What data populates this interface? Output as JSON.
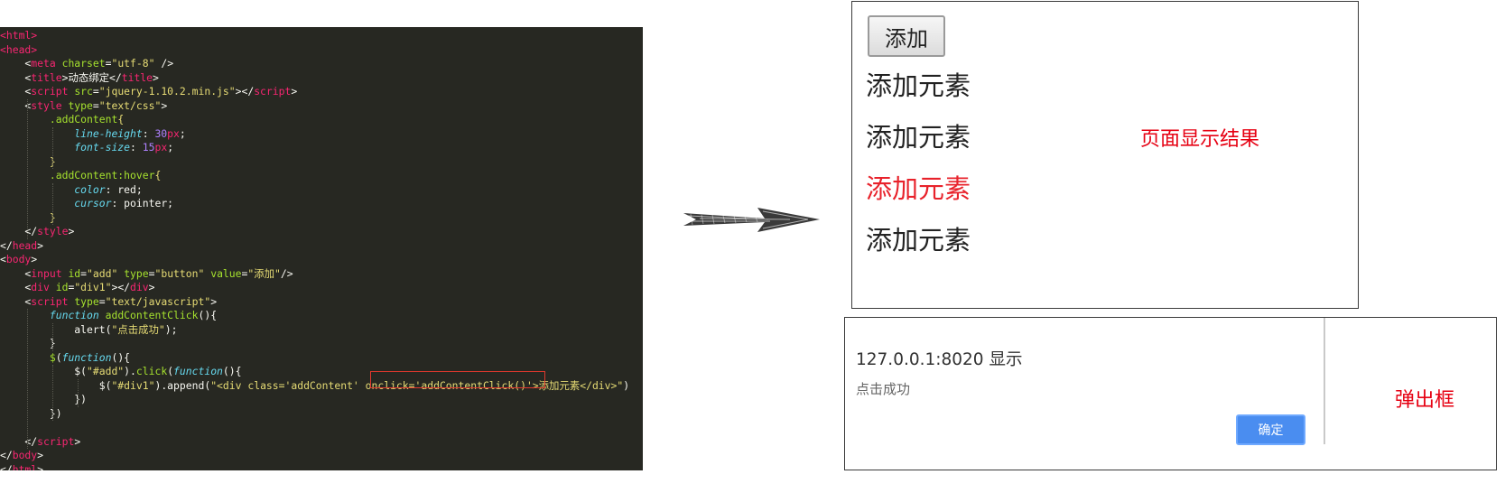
{
  "code": {
    "lines": [
      [
        {
          "c": "tag",
          "t": "<html>"
        }
      ],
      [
        {
          "c": "tag",
          "t": "<head>"
        }
      ],
      [
        {
          "c": "plain",
          "t": "    <"
        },
        {
          "c": "tag",
          "t": "meta"
        },
        {
          "c": "plain",
          "t": " "
        },
        {
          "c": "attr",
          "t": "charset"
        },
        {
          "c": "plain",
          "t": "="
        },
        {
          "c": "str",
          "t": "\"utf-8\""
        },
        {
          "c": "plain",
          "t": " />"
        }
      ],
      [
        {
          "c": "plain",
          "t": "    <"
        },
        {
          "c": "tag",
          "t": "title"
        },
        {
          "c": "plain",
          "t": ">动态绑定</"
        },
        {
          "c": "tag",
          "t": "title"
        },
        {
          "c": "plain",
          "t": ">"
        }
      ],
      [
        {
          "c": "plain",
          "t": "    <"
        },
        {
          "c": "tag",
          "t": "script"
        },
        {
          "c": "plain",
          "t": " "
        },
        {
          "c": "attr",
          "t": "src"
        },
        {
          "c": "plain",
          "t": "="
        },
        {
          "c": "str",
          "t": "\"jquery-1.10.2.min.js\""
        },
        {
          "c": "plain",
          "t": "></"
        },
        {
          "c": "tag",
          "t": "script"
        },
        {
          "c": "plain",
          "t": ">"
        }
      ],
      [
        {
          "c": "plain",
          "t": "    <"
        },
        {
          "c": "tag",
          "t": "style"
        },
        {
          "c": "plain",
          "t": " "
        },
        {
          "c": "attr",
          "t": "type"
        },
        {
          "c": "plain",
          "t": "="
        },
        {
          "c": "str",
          "t": "\"text/css\""
        },
        {
          "c": "plain",
          "t": ">"
        }
      ],
      [
        {
          "c": "plain",
          "t": "        "
        },
        {
          "c": "sel",
          "t": ".addContent"
        },
        {
          "c": "brace",
          "t": "{"
        }
      ],
      [
        {
          "c": "plain",
          "t": "            "
        },
        {
          "c": "prop",
          "t": "line-height"
        },
        {
          "c": "plain",
          "t": ": "
        },
        {
          "c": "num",
          "t": "30"
        },
        {
          "c": "tag",
          "t": "px"
        },
        {
          "c": "plain",
          "t": ";"
        }
      ],
      [
        {
          "c": "plain",
          "t": "            "
        },
        {
          "c": "prop",
          "t": "font-size"
        },
        {
          "c": "plain",
          "t": ": "
        },
        {
          "c": "num",
          "t": "15"
        },
        {
          "c": "tag",
          "t": "px"
        },
        {
          "c": "plain",
          "t": ";"
        }
      ],
      [
        {
          "c": "plain",
          "t": "        "
        },
        {
          "c": "brace",
          "t": "}"
        }
      ],
      [
        {
          "c": "plain",
          "t": "        "
        },
        {
          "c": "sel",
          "t": ".addContent:hover"
        },
        {
          "c": "brace",
          "t": "{"
        }
      ],
      [
        {
          "c": "plain",
          "t": "            "
        },
        {
          "c": "prop",
          "t": "color"
        },
        {
          "c": "plain",
          "t": ": red;"
        }
      ],
      [
        {
          "c": "plain",
          "t": "            "
        },
        {
          "c": "prop",
          "t": "cursor"
        },
        {
          "c": "plain",
          "t": ": pointer;"
        }
      ],
      [
        {
          "c": "plain",
          "t": "        "
        },
        {
          "c": "brace",
          "t": "}"
        }
      ],
      [
        {
          "c": "plain",
          "t": "    </"
        },
        {
          "c": "tag",
          "t": "style"
        },
        {
          "c": "plain",
          "t": ">"
        }
      ],
      [
        {
          "c": "plain",
          "t": "</"
        },
        {
          "c": "tag",
          "t": "head"
        },
        {
          "c": "plain",
          "t": ">"
        }
      ],
      [
        {
          "c": "plain",
          "t": "<"
        },
        {
          "c": "tag",
          "t": "body"
        },
        {
          "c": "plain",
          "t": ">"
        }
      ],
      [
        {
          "c": "plain",
          "t": "    <"
        },
        {
          "c": "tag",
          "t": "input"
        },
        {
          "c": "plain",
          "t": " "
        },
        {
          "c": "attr",
          "t": "id"
        },
        {
          "c": "plain",
          "t": "="
        },
        {
          "c": "str",
          "t": "\"add\""
        },
        {
          "c": "plain",
          "t": " "
        },
        {
          "c": "attr",
          "t": "type"
        },
        {
          "c": "plain",
          "t": "="
        },
        {
          "c": "str",
          "t": "\"button\""
        },
        {
          "c": "plain",
          "t": " "
        },
        {
          "c": "attr",
          "t": "value"
        },
        {
          "c": "plain",
          "t": "="
        },
        {
          "c": "str",
          "t": "\"添加\""
        },
        {
          "c": "plain",
          "t": "/>"
        }
      ],
      [
        {
          "c": "plain",
          "t": "    <"
        },
        {
          "c": "tag",
          "t": "div"
        },
        {
          "c": "plain",
          "t": " "
        },
        {
          "c": "attr",
          "t": "id"
        },
        {
          "c": "plain",
          "t": "="
        },
        {
          "c": "str",
          "t": "\"div1\""
        },
        {
          "c": "plain",
          "t": "></"
        },
        {
          "c": "tag",
          "t": "div"
        },
        {
          "c": "plain",
          "t": ">"
        }
      ],
      [
        {
          "c": "plain",
          "t": "    <"
        },
        {
          "c": "tag",
          "t": "script"
        },
        {
          "c": "plain",
          "t": " "
        },
        {
          "c": "attr",
          "t": "type"
        },
        {
          "c": "plain",
          "t": "="
        },
        {
          "c": "str",
          "t": "\"text/javascript\""
        },
        {
          "c": "plain",
          "t": ">"
        }
      ],
      [
        {
          "c": "plain",
          "t": "        "
        },
        {
          "c": "kw",
          "t": "function"
        },
        {
          "c": "plain",
          "t": " "
        },
        {
          "c": "fn",
          "t": "addContentClick"
        },
        {
          "c": "plain",
          "t": "(){"
        }
      ],
      [
        {
          "c": "plain",
          "t": "            alert("
        },
        {
          "c": "str",
          "t": "\"点击成功\""
        },
        {
          "c": "plain",
          "t": ");"
        }
      ],
      [
        {
          "c": "plain",
          "t": "        }"
        }
      ],
      [
        {
          "c": "plain",
          "t": "        "
        },
        {
          "c": "fn",
          "t": "$"
        },
        {
          "c": "plain",
          "t": "("
        },
        {
          "c": "kw",
          "t": "function"
        },
        {
          "c": "plain",
          "t": "(){"
        }
      ],
      [
        {
          "c": "plain",
          "t": "            $("
        },
        {
          "c": "str",
          "t": "\"#add\""
        },
        {
          "c": "plain",
          "t": ")."
        },
        {
          "c": "fn",
          "t": "click"
        },
        {
          "c": "plain",
          "t": "("
        },
        {
          "c": "kw",
          "t": "function"
        },
        {
          "c": "plain",
          "t": "(){"
        }
      ],
      [
        {
          "c": "plain",
          "t": "                $("
        },
        {
          "c": "str",
          "t": "\"#div1\""
        },
        {
          "c": "plain",
          "t": ").append("
        },
        {
          "c": "str",
          "t": "\"<div class='addContent' onclick='addContentClick()'>添加元素</div>\""
        },
        {
          "c": "plain",
          "t": ")"
        }
      ],
      [
        {
          "c": "plain",
          "t": "            })"
        }
      ],
      [
        {
          "c": "plain",
          "t": "        })"
        }
      ],
      [
        {
          "c": "plain",
          "t": ""
        }
      ],
      [
        {
          "c": "plain",
          "t": "    </"
        },
        {
          "c": "tag",
          "t": "script"
        },
        {
          "c": "plain",
          "t": ">"
        }
      ],
      [
        {
          "c": "plain",
          "t": "</"
        },
        {
          "c": "tag",
          "t": "body"
        },
        {
          "c": "plain",
          "t": ">"
        }
      ],
      [
        {
          "c": "plain",
          "t": "</"
        },
        {
          "c": "tag",
          "t": "html"
        },
        {
          "c": "plain",
          "t": ">"
        }
      ]
    ]
  },
  "result": {
    "button_label": "添加",
    "items": [
      {
        "label": "添加元素",
        "hover": false
      },
      {
        "label": "添加元素",
        "hover": false
      },
      {
        "label": "添加元素",
        "hover": true
      },
      {
        "label": "添加元素",
        "hover": false
      }
    ],
    "caption": "页面显示结果"
  },
  "dialog": {
    "title": "127.0.0.1:8020 显示",
    "message": "点击成功",
    "ok_label": "确定",
    "caption": "弹出框"
  },
  "colors": {
    "editor_bg": "#272822",
    "caption_red": "#e60012",
    "hover_red": "#e8222b",
    "ok_blue": "#4a8df0",
    "highlight_box": "#e0382d"
  }
}
